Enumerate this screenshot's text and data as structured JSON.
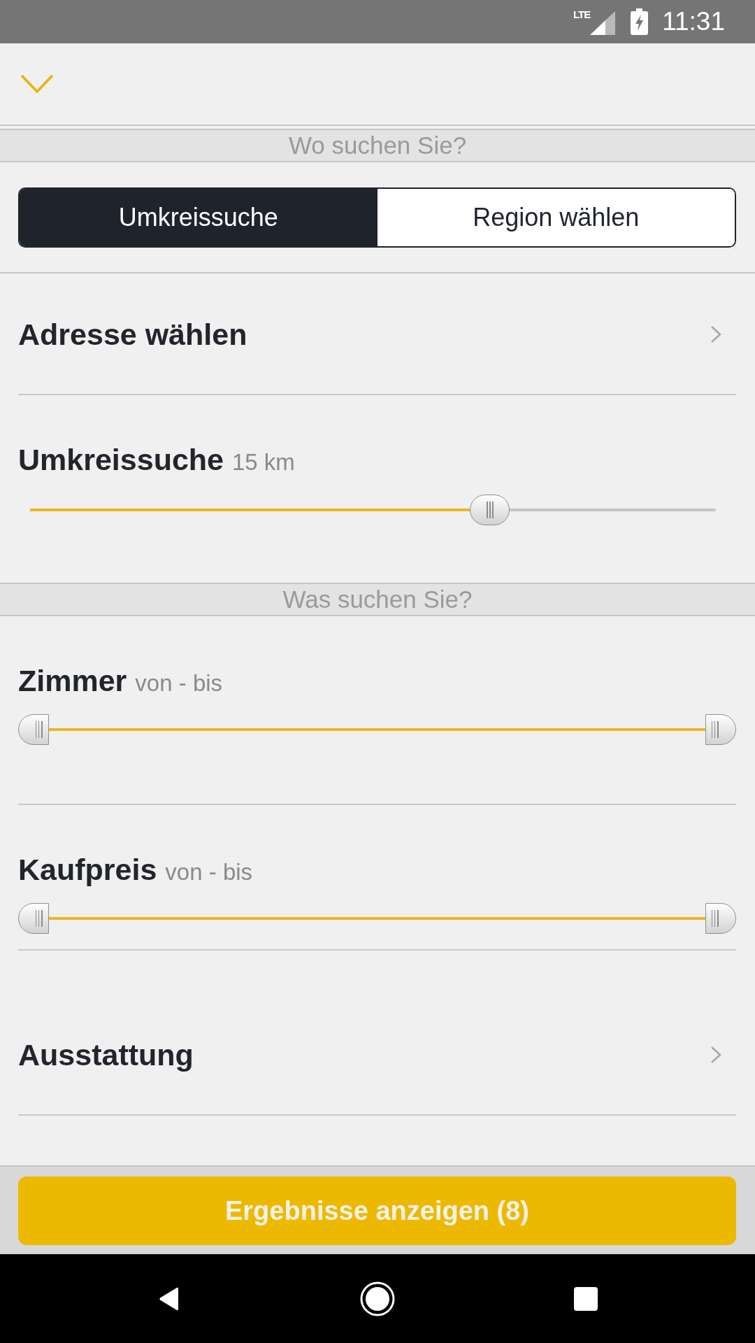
{
  "status_bar": {
    "network": "LTE",
    "time": "11:31"
  },
  "sections": [
    {
      "title": "Wo suchen Sie?",
      "items": [
        {
          "kind": "segmented",
          "options": [
            {
              "label": "Umkreissuche",
              "selected": true
            },
            {
              "label": "Region wählen",
              "selected": false
            }
          ]
        },
        {
          "kind": "link",
          "label": "Adresse wählen"
        },
        {
          "kind": "slider",
          "label": "Umkreissuche",
          "value": "15 km",
          "level": 0.67
        }
      ]
    },
    {
      "title": "Was suchen Sie?",
      "items": [
        {
          "kind": "range",
          "label": "Zimmer",
          "value": "von - bis",
          "thumbs": [
            {
              "level": 0
            },
            {
              "level": 1
            }
          ]
        },
        {
          "kind": "range",
          "label": "Kaufpreis",
          "value": "von - bis",
          "thumbs": [
            {
              "level": 0
            },
            {
              "level": 1
            }
          ]
        },
        {
          "kind": "link",
          "label": "Ausstattung"
        }
      ]
    }
  ],
  "submit_button": {
    "label": "Ergebnisse anzeigen (8)"
  }
}
